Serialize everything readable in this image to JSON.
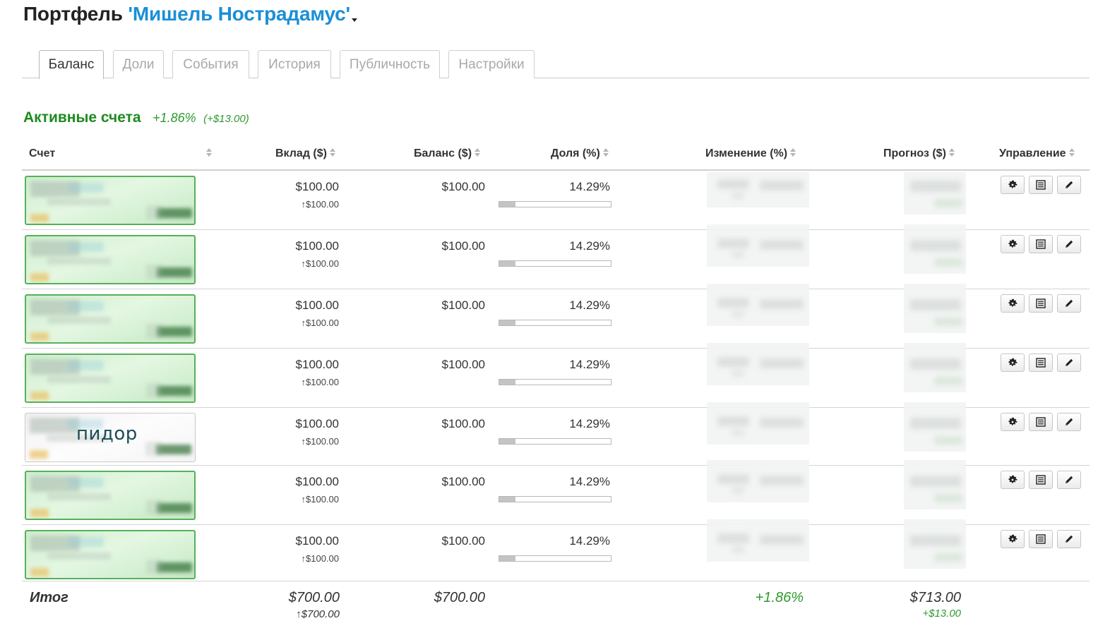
{
  "header": {
    "prefix": "Портфель",
    "portfolio_name": "'Мишель Нострадамус'",
    "suffix": "."
  },
  "tabs": [
    {
      "label": "Баланс",
      "active": true
    },
    {
      "label": "Доли",
      "active": false
    },
    {
      "label": "События",
      "active": false
    },
    {
      "label": "История",
      "active": false
    },
    {
      "label": "Публичность",
      "active": false
    },
    {
      "label": "Настройки",
      "active": false
    }
  ],
  "section": {
    "title": "Активные счета",
    "change_pct": "+1.86%",
    "change_abs": "(+$13.00)"
  },
  "table": {
    "columns": {
      "account": "Счет",
      "deposit": "Вклад ($)",
      "balance": "Баланс ($)",
      "share": "Доля (%)",
      "change": "Изменение (%)",
      "forecast": "Прогноз ($)",
      "manage": "Управление"
    },
    "rows": [
      {
        "deposit": "$100.00",
        "deposit_sub": "↑$100.00",
        "balance": "$100.00",
        "share": "14.29%",
        "share_value": 14.29,
        "style": "green",
        "label": ""
      },
      {
        "deposit": "$100.00",
        "deposit_sub": "↑$100.00",
        "balance": "$100.00",
        "share": "14.29%",
        "share_value": 14.29,
        "style": "green",
        "label": ""
      },
      {
        "deposit": "$100.00",
        "deposit_sub": "↑$100.00",
        "balance": "$100.00",
        "share": "14.29%",
        "share_value": 14.29,
        "style": "green",
        "label": ""
      },
      {
        "deposit": "$100.00",
        "deposit_sub": "↑$100.00",
        "balance": "$100.00",
        "share": "14.29%",
        "share_value": 14.29,
        "style": "green",
        "label": ""
      },
      {
        "deposit": "$100.00",
        "deposit_sub": "↑$100.00",
        "balance": "$100.00",
        "share": "14.29%",
        "share_value": 14.29,
        "style": "plain",
        "label": "пидор"
      },
      {
        "deposit": "$100.00",
        "deposit_sub": "↑$100.00",
        "balance": "$100.00",
        "share": "14.29%",
        "share_value": 14.29,
        "style": "green",
        "label": ""
      },
      {
        "deposit": "$100.00",
        "deposit_sub": "↑$100.00",
        "balance": "$100.00",
        "share": "14.29%",
        "share_value": 14.29,
        "style": "green",
        "label": ""
      }
    ],
    "totals": {
      "label": "Итог",
      "deposit": "$700.00",
      "deposit_sub": "↑$700.00",
      "balance": "$700.00",
      "change": "+1.86%",
      "forecast": "$713.00",
      "forecast_sub": "+$13.00"
    }
  },
  "icons": {
    "settings": "gear-icon",
    "list": "list-icon",
    "edit": "pencil-icon"
  },
  "colors": {
    "accent_blue": "#1a8fd6",
    "positive_green": "#2e9a2e",
    "account_border": "#57b05a"
  }
}
